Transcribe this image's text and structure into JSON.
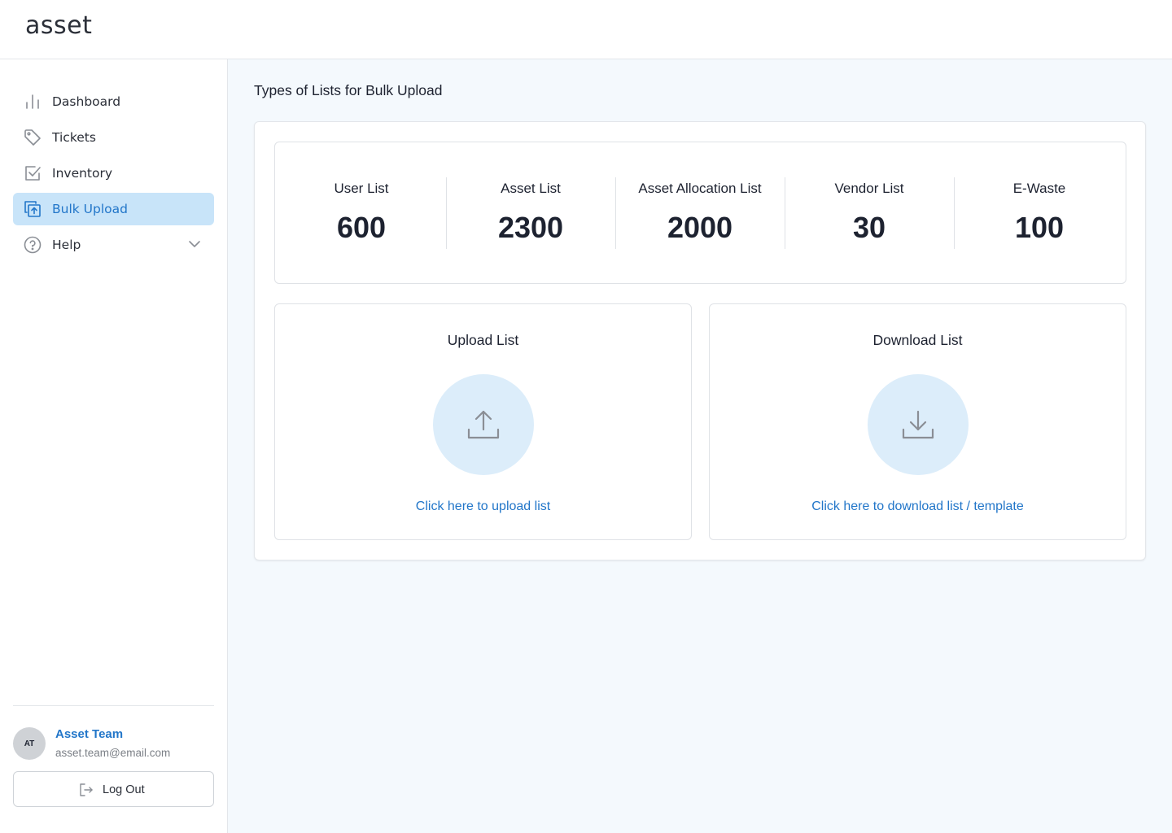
{
  "app": {
    "logo": "asset"
  },
  "sidebar": {
    "items": [
      {
        "label": "Dashboard",
        "icon": "bar-chart-icon"
      },
      {
        "label": "Tickets",
        "icon": "tag-icon"
      },
      {
        "label": "Inventory",
        "icon": "checkbox-icon"
      },
      {
        "label": "Bulk Upload",
        "icon": "bulk-upload-icon",
        "active": true
      },
      {
        "label": "Help",
        "icon": "help-circle-icon",
        "expandable": true
      }
    ]
  },
  "user": {
    "initials": "AT",
    "name": "Asset Team",
    "email": "asset.team@email.com",
    "logout_label": "Log Out"
  },
  "main": {
    "title": "Types of Lists for Bulk Upload",
    "stats": [
      {
        "label": "User List",
        "value": "600"
      },
      {
        "label": "Asset List",
        "value": "2300"
      },
      {
        "label": "Asset Allocation List",
        "value": "2000"
      },
      {
        "label": "Vendor List",
        "value": "30"
      },
      {
        "label": "E-Waste",
        "value": "100"
      }
    ],
    "upload": {
      "title": "Upload List",
      "link": "Click here to upload list",
      "icon": "upload-icon"
    },
    "download": {
      "title": "Download List",
      "link": "Click here to download list / template",
      "icon": "download-icon"
    }
  },
  "colors": {
    "accent": "#2276c9",
    "active_bg": "#c8e4f9",
    "circle_bg": "#dcedfa",
    "page_bg": "#f4f9fd"
  }
}
